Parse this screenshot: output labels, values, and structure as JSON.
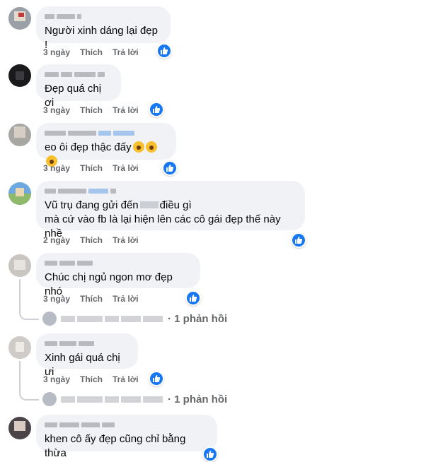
{
  "comments": [
    {
      "text": "Người xinh dáng lại đẹp !",
      "time": "3 ngày",
      "like": "Thích",
      "reply": "Trả lời"
    },
    {
      "text": "Đẹp quá chị ơi",
      "time": "3 ngày",
      "like": "Thích",
      "reply": "Trả lời"
    },
    {
      "text": "eo ôi đẹp thậc đấy",
      "time": "3 ngày",
      "like": "Thích",
      "reply": "Trả lời"
    },
    {
      "text_line1_a": "Vũ trụ đang gửi đến",
      "text_line1_b": "điều gì",
      "text_line2": "mà cứ vào fb là lại hiện lên các cô gái đẹp thế này nhề",
      "time": "2 ngày",
      "like": "Thích",
      "reply": "Trả lời"
    },
    {
      "text": "Chúc chị ngủ ngon mơ đẹp nhó",
      "time": "3 ngày",
      "like": "Thích",
      "reply": "Trả lời",
      "replies": "· 1 phản hồi"
    },
    {
      "text": "Xinh gái quá chị ưi",
      "time": "3 ngày",
      "like": "Thích",
      "reply": "Trả lời",
      "replies": "· 1 phản hồi"
    },
    {
      "text": "khen cô ấy đẹp cũng chỉ bằng thừa"
    }
  ],
  "colors": {
    "bubble": "#f0f2f5",
    "meta": "#65676b",
    "like_blue": "#1877f2",
    "thread": "#ced0d4"
  },
  "icons": {
    "reaction": "like-thumb-icon",
    "emoji": "fearful-face-emoji"
  }
}
